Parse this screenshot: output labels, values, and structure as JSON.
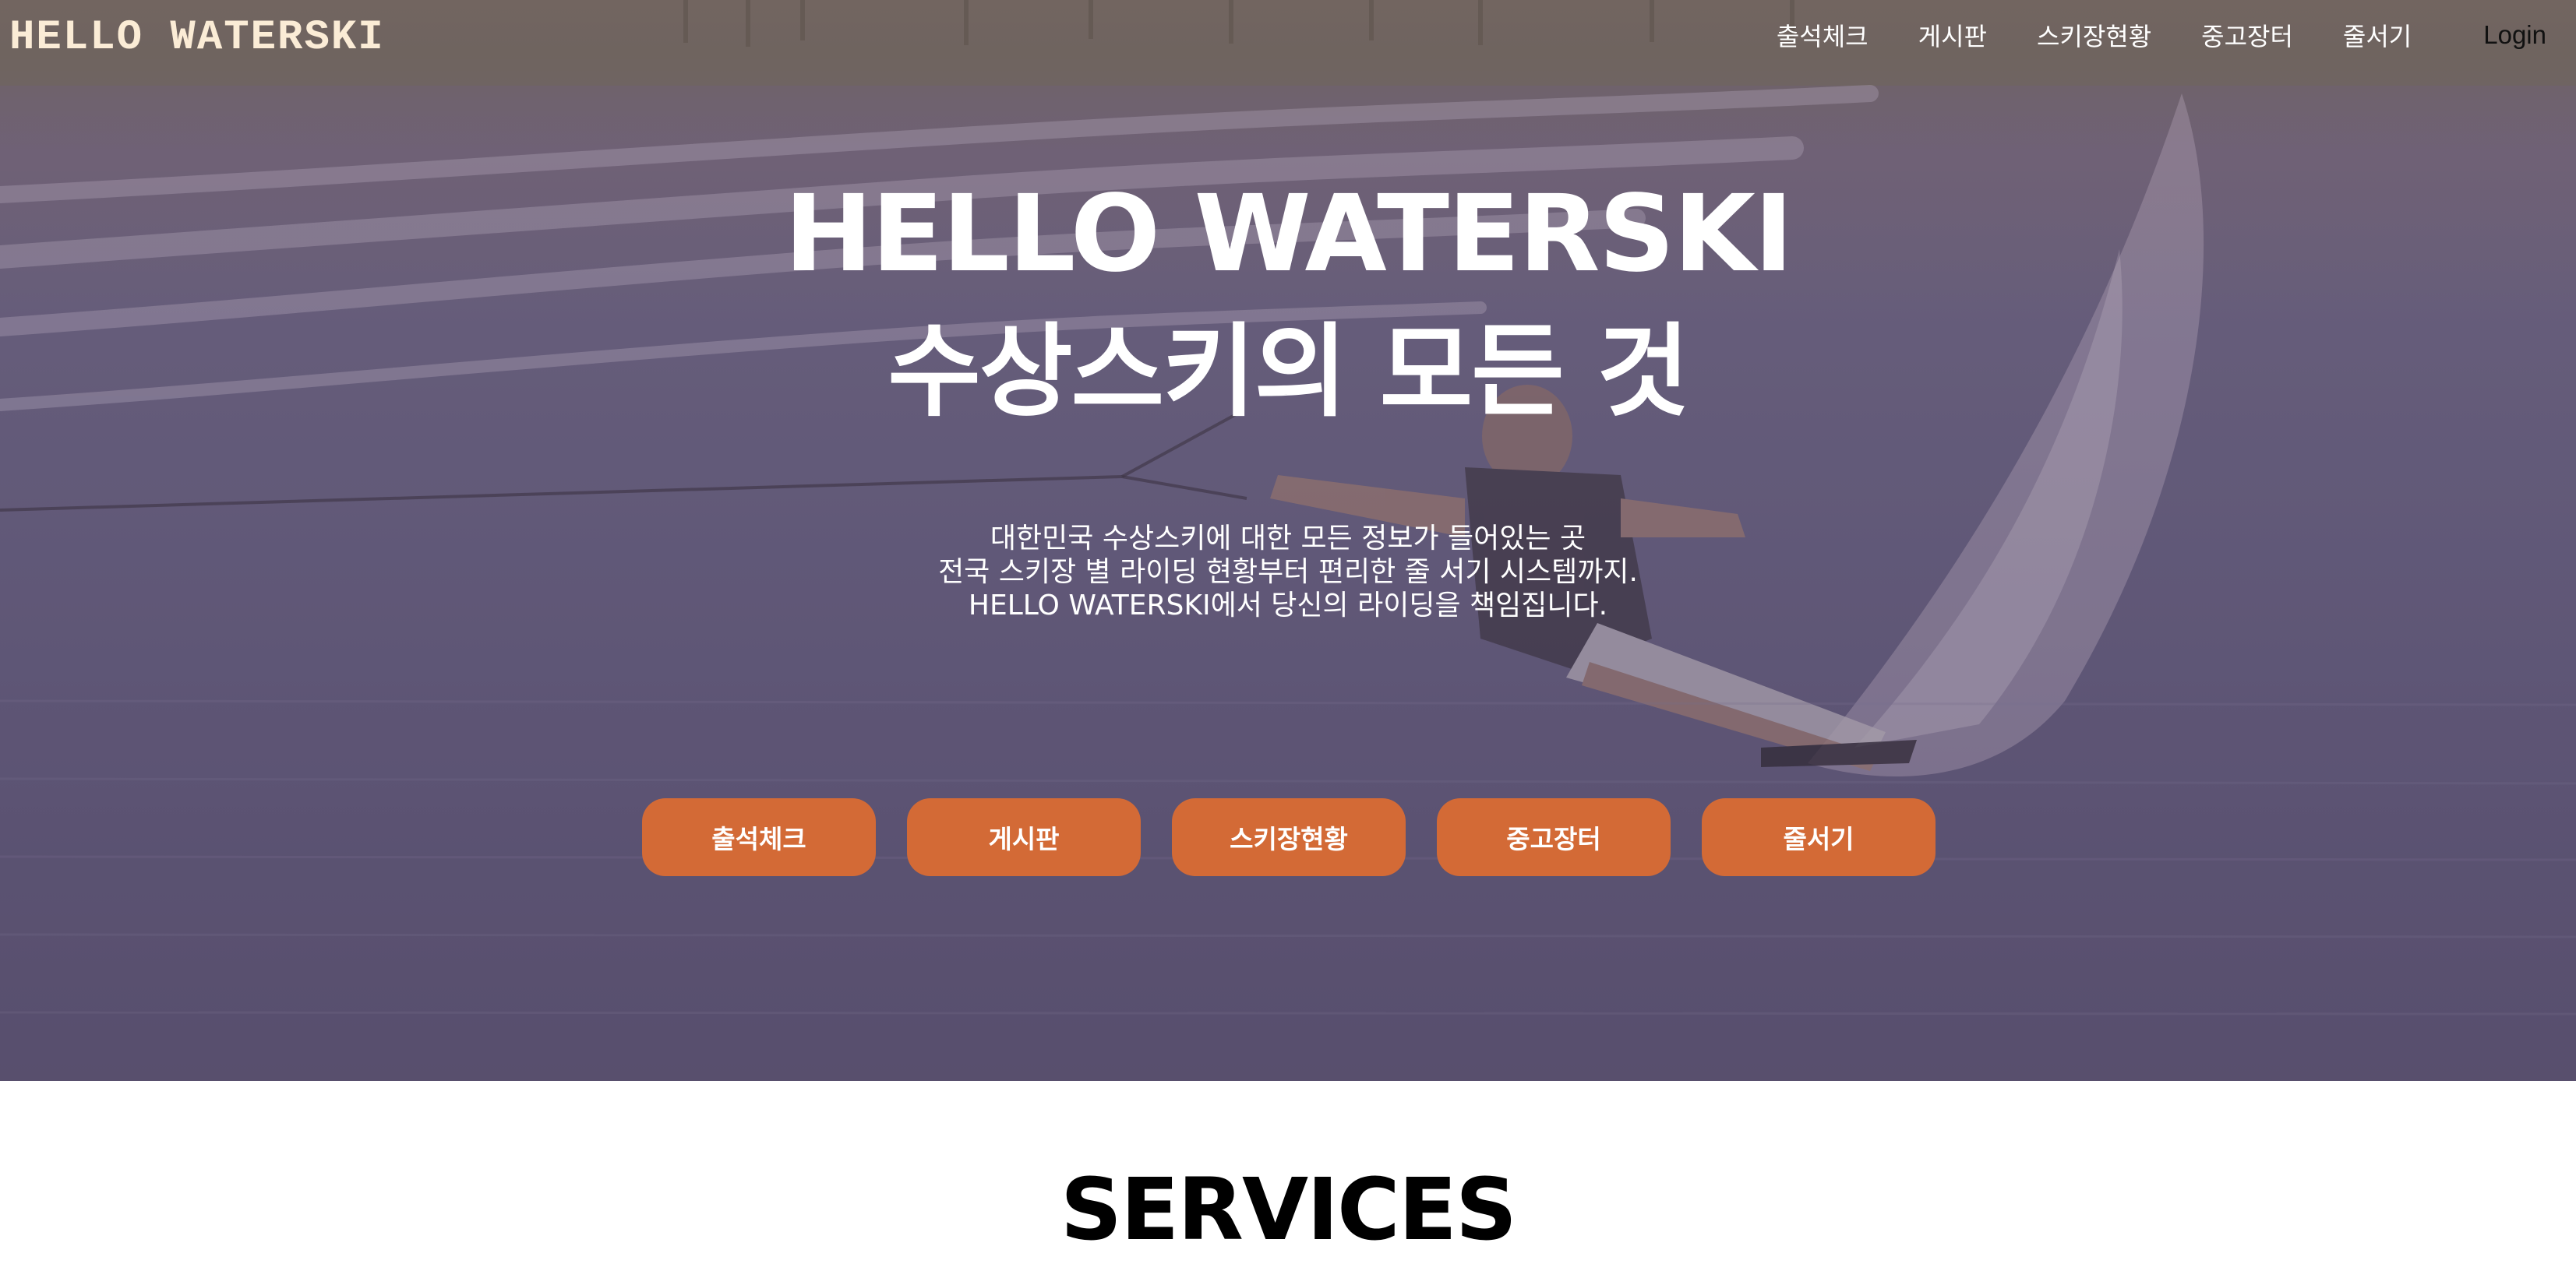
{
  "brand": {
    "name": "HELLO WATERSKI",
    "color": "#fbecd6"
  },
  "nav": {
    "items": [
      {
        "label": "출석체크"
      },
      {
        "label": "게시판"
      },
      {
        "label": "스키장현황"
      },
      {
        "label": "중고장터"
      },
      {
        "label": "줄서기"
      }
    ],
    "login_label": "Login"
  },
  "hero": {
    "title_line1": "HELLO WATERSKI",
    "title_line2": "수상스키의 모든 것",
    "description": [
      "대한민국 수상스키에 대한 모든 정보가 들어있는 곳",
      "전국 스키장 별 라이딩 현황부터 편리한 줄 서기 시스템까지.",
      "HELLO WATERSKI에서 당신의 라이딩을 책임집니다."
    ],
    "buttons": [
      {
        "label": "출석체크"
      },
      {
        "label": "게시판"
      },
      {
        "label": "스키장현황"
      },
      {
        "label": "중고장터"
      },
      {
        "label": "줄서기"
      }
    ],
    "button_color": "#d36a36"
  },
  "services": {
    "title": "SERVICES"
  }
}
